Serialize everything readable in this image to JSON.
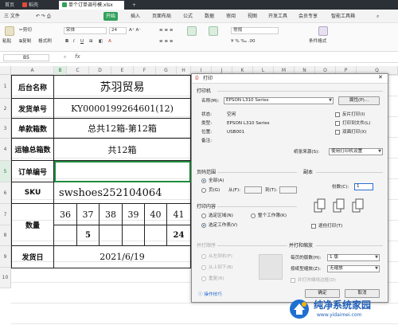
{
  "tabs": [
    {
      "label": "首页",
      "active": false
    },
    {
      "label": "稻壳",
      "active": false
    },
    {
      "label": "单个订单调号模.xlsx",
      "active": true
    }
  ],
  "menu": [
    "三 文件",
    "开始",
    "插入",
    "页面布局",
    "公式",
    "数据",
    "审阅",
    "视图",
    "开发工具",
    "会员专享",
    "智能工具箱"
  ],
  "menu_active": "开始",
  "ribbon": {
    "paste": "粘贴",
    "cut": "剪切",
    "copy": "复制",
    "format_painter": "格式刷",
    "font_name": "宋体",
    "font_size": "24",
    "style_normal": "常规",
    "conditional_format": "条件格式"
  },
  "formula_bar": {
    "name_box": "B5",
    "fx": "fx",
    "content": ""
  },
  "columns": [
    "A",
    "B",
    "C",
    "D",
    "E",
    "F",
    "G",
    "H",
    "I",
    "J",
    "K",
    "L",
    "M",
    "N",
    "O",
    "P",
    "Q"
  ],
  "selected_column": "B",
  "rows": [
    "1",
    "2",
    "3",
    "4",
    "5",
    "6",
    "7",
    "8",
    "9",
    "10"
  ],
  "selected_row": "5",
  "sheet": {
    "r1": {
      "label": "后台名称",
      "value": "苏羽贸易"
    },
    "r2": {
      "label": "发货单号",
      "value": "KY0000199264601(12)"
    },
    "r3": {
      "label": "单款箱数",
      "value": "总共12箱-第12箱"
    },
    "r4": {
      "label": "运输总箱数",
      "value": "共12箱"
    },
    "r5": {
      "label": "订单编号",
      "value": ""
    },
    "r6": {
      "label": "SKU",
      "value": "swshoes252104064"
    },
    "r78": {
      "label": "数量",
      "sizes": [
        "36",
        "37",
        "38",
        "39",
        "40",
        "41"
      ],
      "quantities": [
        "",
        "5",
        "",
        "",
        "",
        "24"
      ]
    },
    "r9": {
      "label": "发货日",
      "value": "2021/6/19"
    }
  },
  "dialog": {
    "title": "打印",
    "printer_section": "打印机",
    "name_label": "名称(M):",
    "printer_name": "EPSON L310 Series",
    "properties_button": "属性(P)...",
    "status_label": "状态:",
    "status_value": "空闲",
    "type_label": "类型:",
    "type_value": "EPSON L310 Series",
    "location_label": "位置:",
    "location_value": "USB001",
    "comment_label": "备注:",
    "reverse_print": "反片打印(I)",
    "print_to_file": "打印到文件(L)",
    "duplex": "双面打印(X)",
    "paper_source_label": "纸张来源(S):",
    "paper_source_value": "使用打印机设置",
    "page_range_section": "页码范围",
    "all_pages": "全部(A)",
    "pages": "页(G)",
    "from_label": "从(F):",
    "to_label": "到(T):",
    "print_content_section": "打印内容",
    "selection": "选定区域(N)",
    "whole_workbook": "整个工作簿(K)",
    "active_sheet": "选定工作表(V)",
    "copies_section": "副本",
    "copies_label": "份数(C):",
    "copies_value": "1",
    "collate": "逐份打印(T)",
    "print_order_section": "并打顺序",
    "left_to_right": "从左到右(F)",
    "top_to_bottom": "从上到下(B)",
    "repeat": "重复(R)",
    "zoom_section": "并打和缩放",
    "pages_per_sheet_label": "每页的版数(H):",
    "pages_per_sheet_value": "1 版",
    "scale_label": "按纸型缩放(Z):",
    "scale_value": "无缩放",
    "print_tip": "并打时细线边框(D)",
    "tips_link": "操作技巧",
    "ok_button": "确定",
    "cancel_button": "取消"
  },
  "watermark": {
    "text": "纯净系统家园",
    "url": "www.yidaimei.com"
  },
  "colors": {
    "accent": "#31a15a",
    "selection": "#1e8c3e",
    "tabbar": "#2b2f36"
  }
}
